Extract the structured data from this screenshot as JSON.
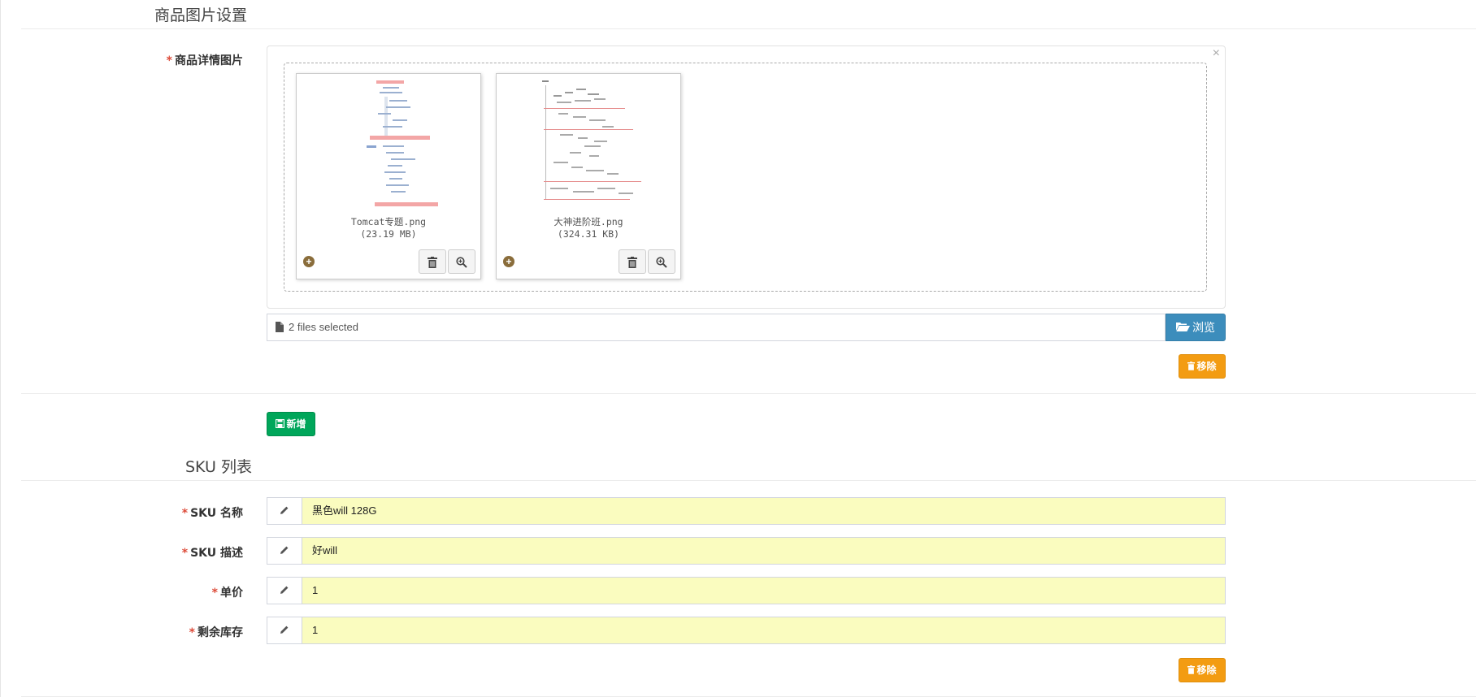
{
  "image_section": {
    "title": "商品图片设置",
    "detail_images_label": "商品详情图片",
    "required_mark": "*",
    "close_glyph": "×",
    "files": [
      {
        "name": "Tomcat专题.png",
        "size": "(23.19 MB)"
      },
      {
        "name": "大神进阶班.png",
        "size": "(324.31 KB)"
      }
    ],
    "file_caption": "2 files selected",
    "browse_label": "浏览",
    "remove_label": "移除"
  },
  "add_label": "新增",
  "sku_section": {
    "title": "SKU 列表",
    "fields": [
      {
        "label": "SKU 名称",
        "value": "黑色will 128G"
      },
      {
        "label": "SKU 描述",
        "value": "好will"
      },
      {
        "label": "单价",
        "value": "1"
      },
      {
        "label": "剩余库存",
        "value": "1"
      }
    ],
    "remove_label": "移除"
  },
  "colors": {
    "primary": "#3c8dbc",
    "warning": "#f39c12",
    "success": "#00a65a",
    "required": "#dd4b39",
    "input_fill": "#fafcbf"
  },
  "icons": {
    "file": "file-icon",
    "folder_open": "folder-open-icon",
    "trash": "trash-icon",
    "zoom": "zoom-in-icon",
    "plus_circle": "plus-circle-icon",
    "pencil": "pencil-icon",
    "save": "save-icon"
  }
}
